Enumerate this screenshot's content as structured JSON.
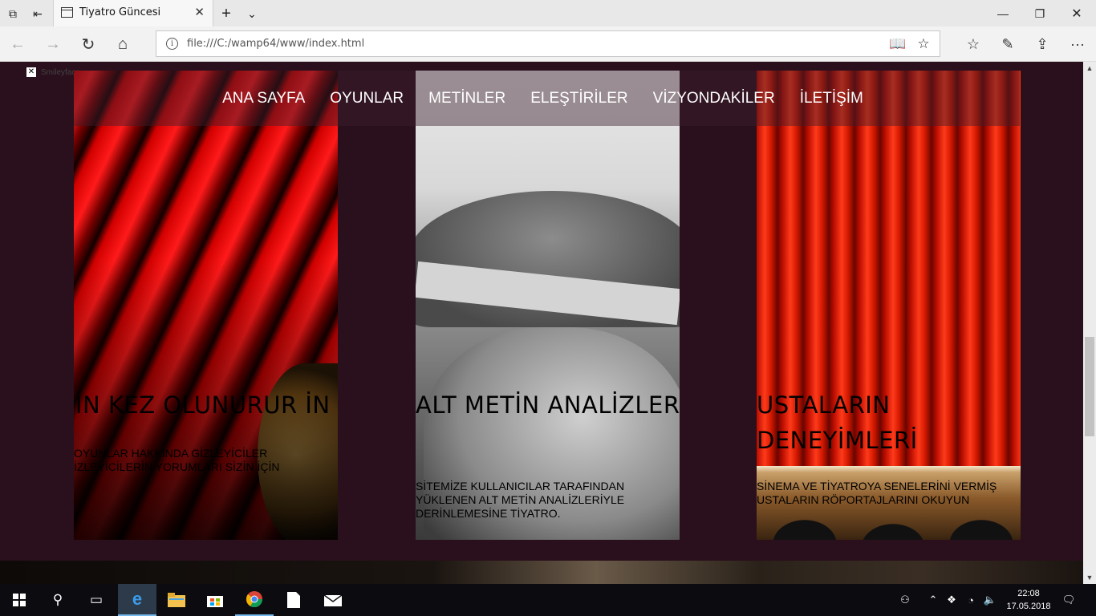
{
  "browser": {
    "tab_title": "Tiyatro Güncesi",
    "url": "file:///C:/wamp64/www/index.html"
  },
  "page": {
    "broken_image_alt": "Smileyface",
    "nav": [
      "ANA SAYFA",
      "OYUNLAR",
      "METİNLER",
      "ELEŞTİRİLER",
      "VİZYONDAKİLER",
      "İLETİŞİM"
    ],
    "cards": [
      {
        "title": "İN KEZ OLUNURUR İN",
        "text": "OYUNLAR HAKKINDA GİZLEYİCİLER İZLEYİCİLERİN YORUMLARI SİZİN İÇİN"
      },
      {
        "title": "ALT METİN ANALİZLERİ",
        "text": "SİTEMİZE KULLANICILAR TARAFINDAN YÜKLENEN ALT METİN ANALİZLERİYLE DERİNLEMESİNE TİYATRO."
      },
      {
        "title": "USTALARIN DENEYİMLERİ",
        "text": "SİNEMA VE TİYATROYA SENELERİNİ VERMİŞ USTALARIN RÖPORTAJLARINI OKUYUN"
      }
    ]
  },
  "taskbar": {
    "time": "22:08",
    "date": "17.05.2018"
  },
  "icons": {
    "start": "windows-icon",
    "search": "search-icon",
    "task_view": "task-view-icon",
    "edge": "edge-icon",
    "explorer": "folder-icon",
    "store": "store-icon",
    "chrome": "chrome-icon",
    "notepad": "document-icon",
    "mail": "mail-icon"
  }
}
